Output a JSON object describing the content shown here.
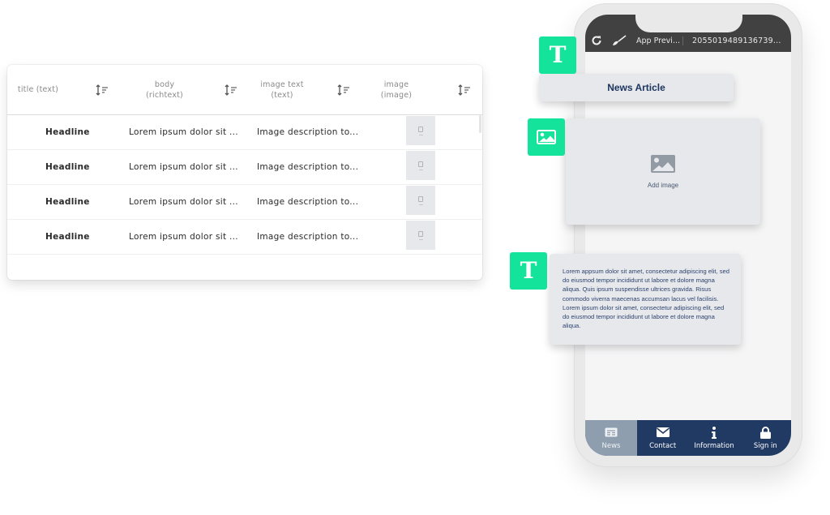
{
  "table": {
    "columns": [
      {
        "label_line1": "title (text)",
        "label_line2": ""
      },
      {
        "label_line1": "body",
        "label_line2": "(richtext)"
      },
      {
        "label_line1": "image text",
        "label_line2": "(text)"
      },
      {
        "label_line1": "image",
        "label_line2": "(image)"
      }
    ],
    "sort_icon": "sort-icon",
    "rows": [
      {
        "title": "Headline",
        "body": "Lorem ipsum dolor sit ...",
        "image_text": "Image description to...",
        "image": "image-thumbnail"
      },
      {
        "title": "Headline",
        "body": "Lorem ipsum dolor sit ...",
        "image_text": "Image description to...",
        "image": "image-thumbnail"
      },
      {
        "title": "Headline",
        "body": "Lorem ipsum dolor sit ...",
        "image_text": "Image description to...",
        "image": "image-thumbnail"
      },
      {
        "title": "Headline",
        "body": "Lorem ipsum dolor sit ...",
        "image_text": "Image description to...",
        "image": "image-thumbnail"
      }
    ]
  },
  "phone": {
    "topbar": {
      "refresh_icon": "refresh-icon",
      "brush_icon": "brush-icon",
      "app_name": "App Previ...",
      "app_id": "2055019489136739..."
    },
    "components": {
      "title_text": "News Article",
      "image_placeholder_label": "Add image",
      "body_text": "Lorem appsum dolor sit amet, consectetur adipiscing elit, sed do eiusmod tempor incididunt ut labore et dolore magna aliqua. Quis ipsum suspendisse ultrices gravida. Risus commodo viverra maecenas accumsan lacus vel facilisis. Lorem ipsum dolor sit amet, consectetur adipiscing elit, sed do eiusmod tempor incididunt ut labore et dolore magna aliqua."
    },
    "badges": {
      "text_badge_glyph": "T",
      "image_badge_icon": "image-icon"
    },
    "navbar": {
      "tabs": [
        {
          "label": "News",
          "icon": "news-icon",
          "active": true
        },
        {
          "label": "Contact",
          "icon": "envelope-icon",
          "active": false
        },
        {
          "label": "Information",
          "icon": "info-icon",
          "active": false
        },
        {
          "label": "Sign in",
          "icon": "lock-icon",
          "active": false
        }
      ]
    }
  },
  "colors": {
    "accent_green": "#14e39b",
    "navbar_blue": "#213a63",
    "navbar_active": "#8e9eae",
    "topbar_dark": "#414141",
    "title_text": "#1e3560"
  }
}
